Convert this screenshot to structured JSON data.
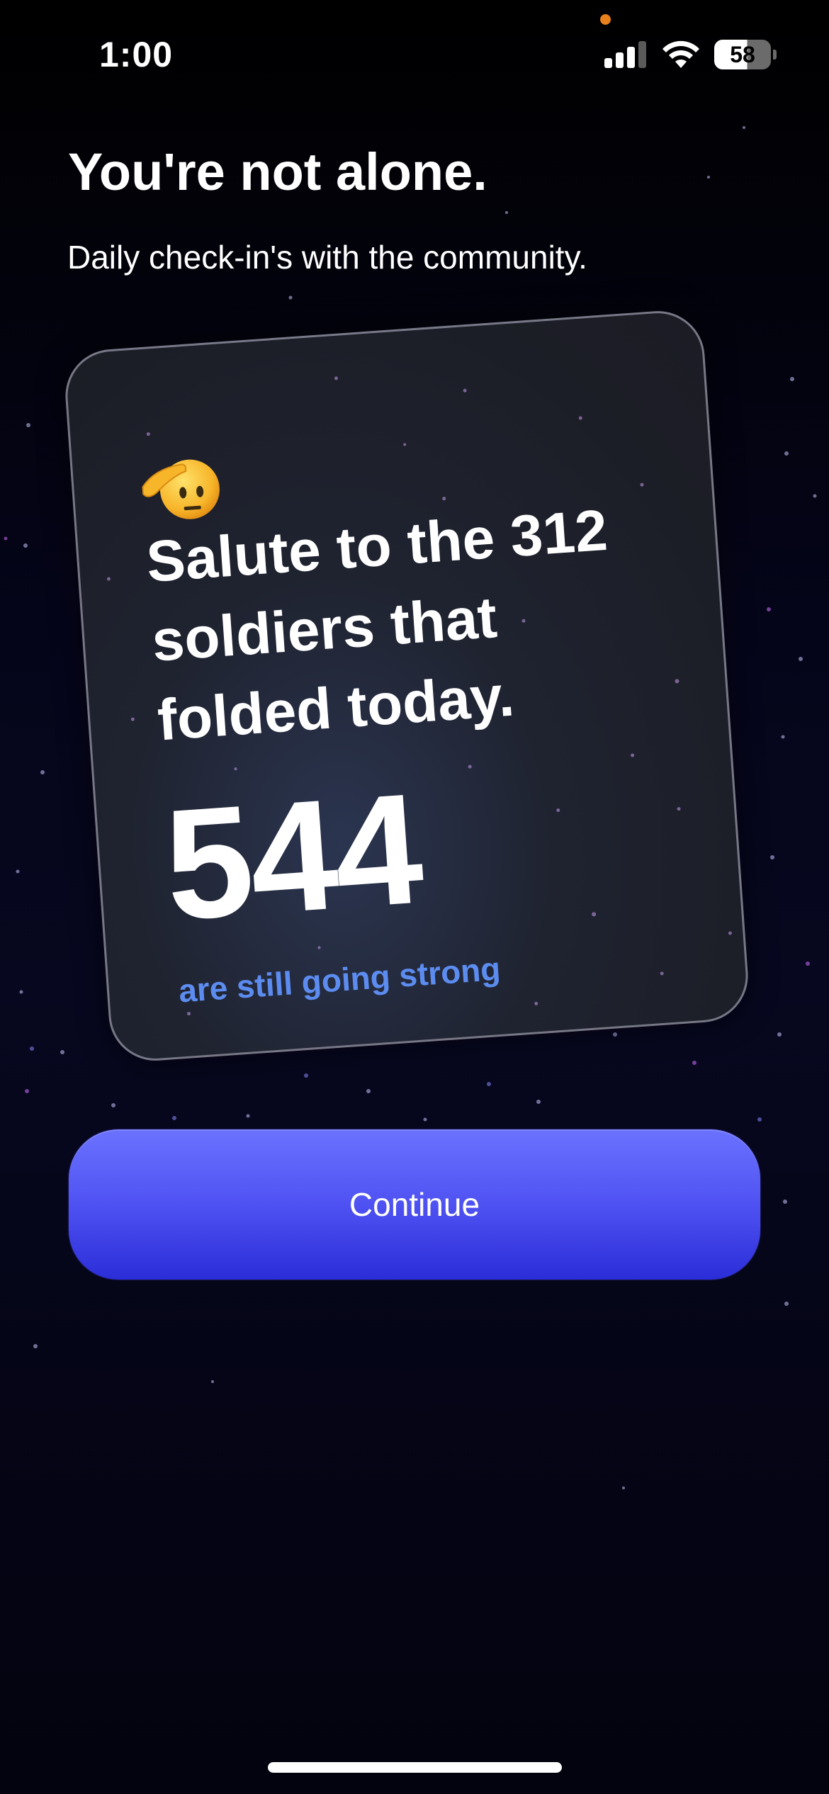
{
  "status_bar": {
    "time": "1:00",
    "battery_level": "58",
    "icons": [
      "signal-icon",
      "wifi-icon",
      "battery-icon"
    ],
    "privacy_indicator_color": "#e8801c"
  },
  "header": {
    "title": "You're not alone.",
    "subtitle": "Daily check-in's with the community."
  },
  "card": {
    "icon": "saluting-face-icon",
    "message": "Salute to the 312 soldiers that folded today.",
    "count": "544",
    "caption": "are still going strong",
    "caption_color": "#5c8cf0"
  },
  "continue_button": {
    "label": "Continue",
    "color_top": "#6b72ff",
    "color_bottom": "#2b2dd8"
  }
}
